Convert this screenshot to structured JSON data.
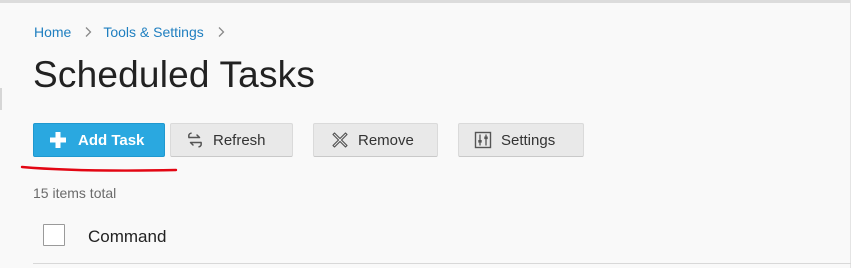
{
  "breadcrumb": {
    "items": [
      {
        "label": "Home"
      },
      {
        "label": "Tools & Settings"
      }
    ],
    "separator_icon": "chevron-right-icon"
  },
  "page": {
    "title": "Scheduled Tasks"
  },
  "toolbar": {
    "add_task": {
      "label": "Add Task",
      "icon": "plus-icon"
    },
    "refresh": {
      "label": "Refresh",
      "icon": "refresh-icon"
    },
    "remove": {
      "label": "Remove",
      "icon": "remove-icon"
    },
    "settings": {
      "label": "Settings",
      "icon": "settings-sliders-icon"
    }
  },
  "list": {
    "items_total": "15 items total",
    "columns": [
      "Command"
    ]
  },
  "colors": {
    "accent": "#2aa8e0",
    "link": "#1f7fc0",
    "annotation": "#e30613"
  }
}
